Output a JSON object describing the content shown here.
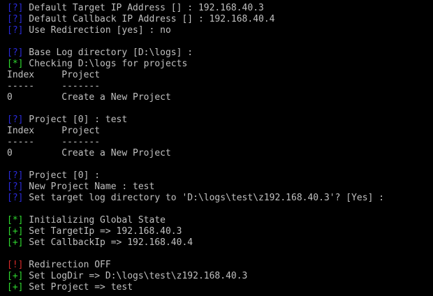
{
  "colors": {
    "background": "#000000",
    "text": "#c0c0c0",
    "question": "#2a2ad8",
    "info": "#2fd82f",
    "success": "#2fd82f",
    "warning": "#d82a2a"
  },
  "lines": [
    {
      "prefix": "[?]",
      "kind": "question",
      "text": " Default Target IP Address [] : 192.168.40.3"
    },
    {
      "prefix": "[?]",
      "kind": "question",
      "text": " Default Callback IP Address [] : 192.168.40.4"
    },
    {
      "prefix": "[?]",
      "kind": "question",
      "text": " Use Redirection [yes] : no"
    },
    {
      "prefix": "",
      "kind": "plain",
      "text": ""
    },
    {
      "prefix": "[?]",
      "kind": "question",
      "text": " Base Log directory [D:\\logs] :"
    },
    {
      "prefix": "[*]",
      "kind": "info",
      "text": " Checking D:\\logs for projects"
    },
    {
      "prefix": "",
      "kind": "plain",
      "text": "Index     Project"
    },
    {
      "prefix": "",
      "kind": "plain",
      "text": "-----     -------"
    },
    {
      "prefix": "",
      "kind": "plain",
      "text": "0         Create a New Project"
    },
    {
      "prefix": "",
      "kind": "plain",
      "text": ""
    },
    {
      "prefix": "[?]",
      "kind": "question",
      "text": " Project [0] : test"
    },
    {
      "prefix": "",
      "kind": "plain",
      "text": "Index     Project"
    },
    {
      "prefix": "",
      "kind": "plain",
      "text": "-----     -------"
    },
    {
      "prefix": "",
      "kind": "plain",
      "text": "0         Create a New Project"
    },
    {
      "prefix": "",
      "kind": "plain",
      "text": ""
    },
    {
      "prefix": "[?]",
      "kind": "question",
      "text": " Project [0] :"
    },
    {
      "prefix": "[?]",
      "kind": "question",
      "text": " New Project Name : test"
    },
    {
      "prefix": "[?]",
      "kind": "question",
      "text": " Set target log directory to 'D:\\logs\\test\\z192.168.40.3'? [Yes] :"
    },
    {
      "prefix": "",
      "kind": "plain",
      "text": ""
    },
    {
      "prefix": "[*]",
      "kind": "info",
      "text": " Initializing Global State"
    },
    {
      "prefix": "[+]",
      "kind": "success",
      "text": " Set TargetIp => 192.168.40.3"
    },
    {
      "prefix": "[+]",
      "kind": "success",
      "text": " Set CallbackIp => 192.168.40.4"
    },
    {
      "prefix": "",
      "kind": "plain",
      "text": ""
    },
    {
      "prefix": "[!]",
      "kind": "warning",
      "text": " Redirection OFF"
    },
    {
      "prefix": "[+]",
      "kind": "success",
      "text": " Set LogDir => D:\\logs\\test\\z192.168.40.3"
    },
    {
      "prefix": "[+]",
      "kind": "success",
      "text": " Set Project => test"
    }
  ]
}
